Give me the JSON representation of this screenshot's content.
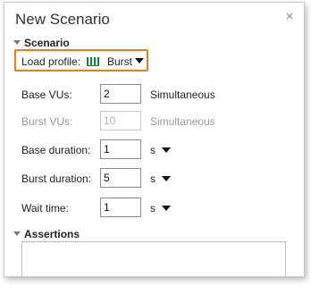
{
  "dialog": {
    "title": "New Scenario",
    "close_icon": "close-icon",
    "close_glyph": "×"
  },
  "scenario_section": {
    "title": "Scenario",
    "load_profile_label": "Load profile:",
    "load_profile_icon": "burst-chart-icon",
    "load_profile_value": "Burst",
    "highlight_color": "#ee7d15"
  },
  "fields": {
    "base_vus": {
      "label": "Base VUs:",
      "value": "2",
      "unit": "Simultaneous"
    },
    "burst_vus": {
      "label": "Burst VUs:",
      "value": "10",
      "unit": "Simultaneous",
      "disabled": true
    },
    "base_duration": {
      "label": "Base duration:",
      "value": "1",
      "unit": "s"
    },
    "burst_duration": {
      "label": "Burst duration:",
      "value": "5",
      "unit": "s"
    },
    "wait_time": {
      "label": "Wait time:",
      "value": "1",
      "unit": "s"
    }
  },
  "assertions_section": {
    "title": "Assertions"
  }
}
